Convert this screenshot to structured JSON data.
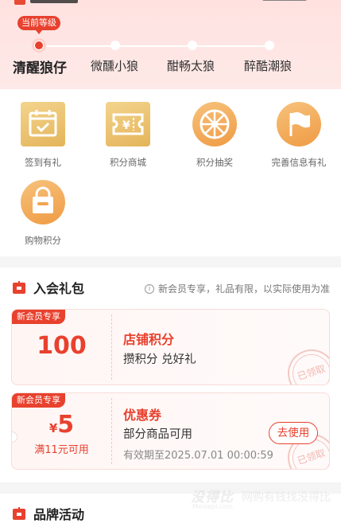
{
  "levels": {
    "current_badge": "当前等级",
    "items": [
      {
        "name": "清醒狼仔",
        "active": true
      },
      {
        "name": "微醺小狼",
        "active": false
      },
      {
        "name": "酣畅太狼",
        "active": false
      },
      {
        "name": "醉酷潮狼",
        "active": false
      }
    ]
  },
  "features": [
    {
      "label": "签到有礼",
      "icon": "calendar-check-icon"
    },
    {
      "label": "积分商城",
      "icon": "coupon-ticket-icon"
    },
    {
      "label": "积分抽奖",
      "icon": "lottery-wheel-icon"
    },
    {
      "label": "完善信息有礼",
      "icon": "flag-icon"
    },
    {
      "label": "购物积分",
      "icon": "shopping-bag-icon"
    }
  ],
  "gift_section": {
    "title": "入会礼包",
    "note": "新会员专享，礼品有限，以实际使用为准",
    "cards": [
      {
        "tag": "新会员专享",
        "amount": "100",
        "title": "店铺积分",
        "subtitle": "攒积分 兑好礼",
        "stamp": "已领取"
      },
      {
        "tag": "新会员专享",
        "currency": "¥",
        "amount": "5",
        "condition": "满11元可用",
        "title": "优惠券",
        "subtitle": "部分商品可用",
        "expiry": "有效期至2025.07.01 00:00:59",
        "button": "去使用",
        "stamp": "已领取"
      }
    ]
  },
  "brand_section": {
    "title": "品牌活动"
  },
  "watermark": {
    "logo": "没得比",
    "slogan": "网购有钱找没得比",
    "url": "Meidebi.com"
  },
  "colors": {
    "accent": "#e8412e",
    "gold": "#e4b45a",
    "orange": "#ef9b43"
  }
}
